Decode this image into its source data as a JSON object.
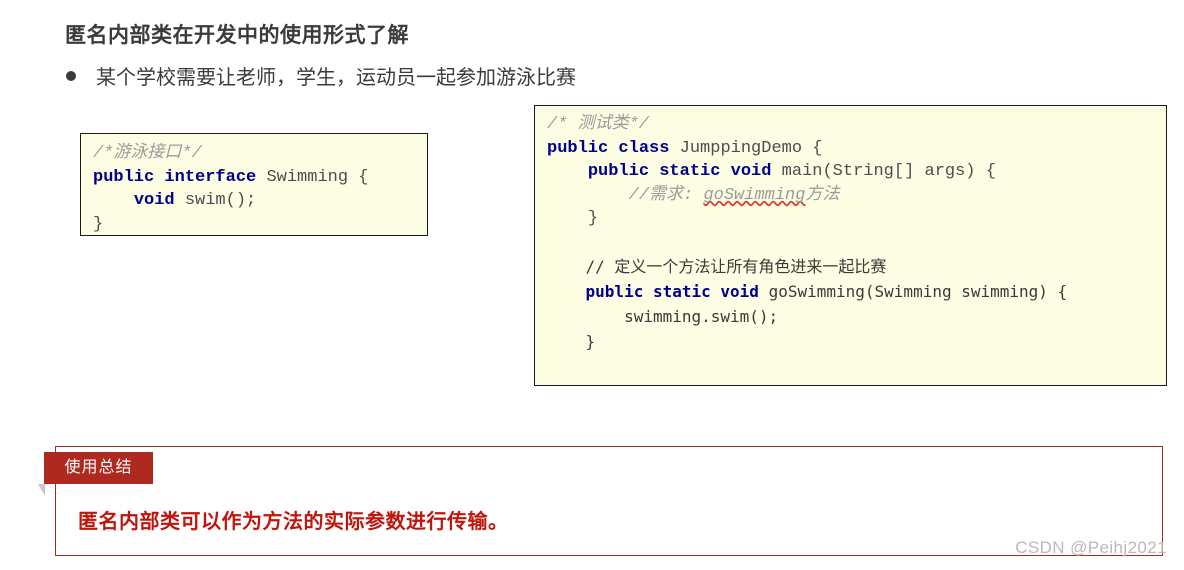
{
  "slide": {
    "title": "匿名内部类在开发中的使用形式了解",
    "bullet": "某个学校需要让老师，学生，运动员一起参加游泳比赛"
  },
  "code_left": {
    "comment": "/*游泳接口*/",
    "kw_public": "public",
    "kw_interface": "interface",
    "class_name": " Swimming {",
    "kw_void": "void",
    "method": " swim();",
    "close_brace": "}"
  },
  "code_right": {
    "comment_class": "/* 测试类*/",
    "kw_public_1": "public",
    "kw_class": "class",
    "class_name": " JumppingDemo {",
    "kw_public_2": "public",
    "kw_static_1": "static",
    "kw_void_1": "void",
    "main_signature": " main(String[] args) {",
    "comment_need_prefix": "//需求: ",
    "comment_need_link": "goSwimming",
    "comment_need_suffix": "方法",
    "close_brace_1": "}",
    "comment_define": "// 定义一个方法让所有角色进来一起比赛",
    "kw_public_3": "public",
    "kw_static_2": "static",
    "kw_void_2": "void",
    "go_swimming_signature": " goSwimming(Swimming swimming) {",
    "call_swim": "swimming.swim();",
    "close_brace_2": "}",
    "close_brace_3": "}"
  },
  "summary": {
    "tab_label": "使用总结",
    "text": "匿名内部类可以作为方法的实际参数进行传输。"
  },
  "watermark": {
    "text": "CSDN @Peihj2021"
  },
  "colors": {
    "keyword": "#00008f",
    "comment": "#9b9b9b",
    "code_bg": "#fdfde4",
    "code_border": "#1a1a1a",
    "summary_accent": "#ae2a21",
    "summary_text": "#c0150d",
    "squiggle": "#d63a2f",
    "title": "#3b3b3b"
  }
}
